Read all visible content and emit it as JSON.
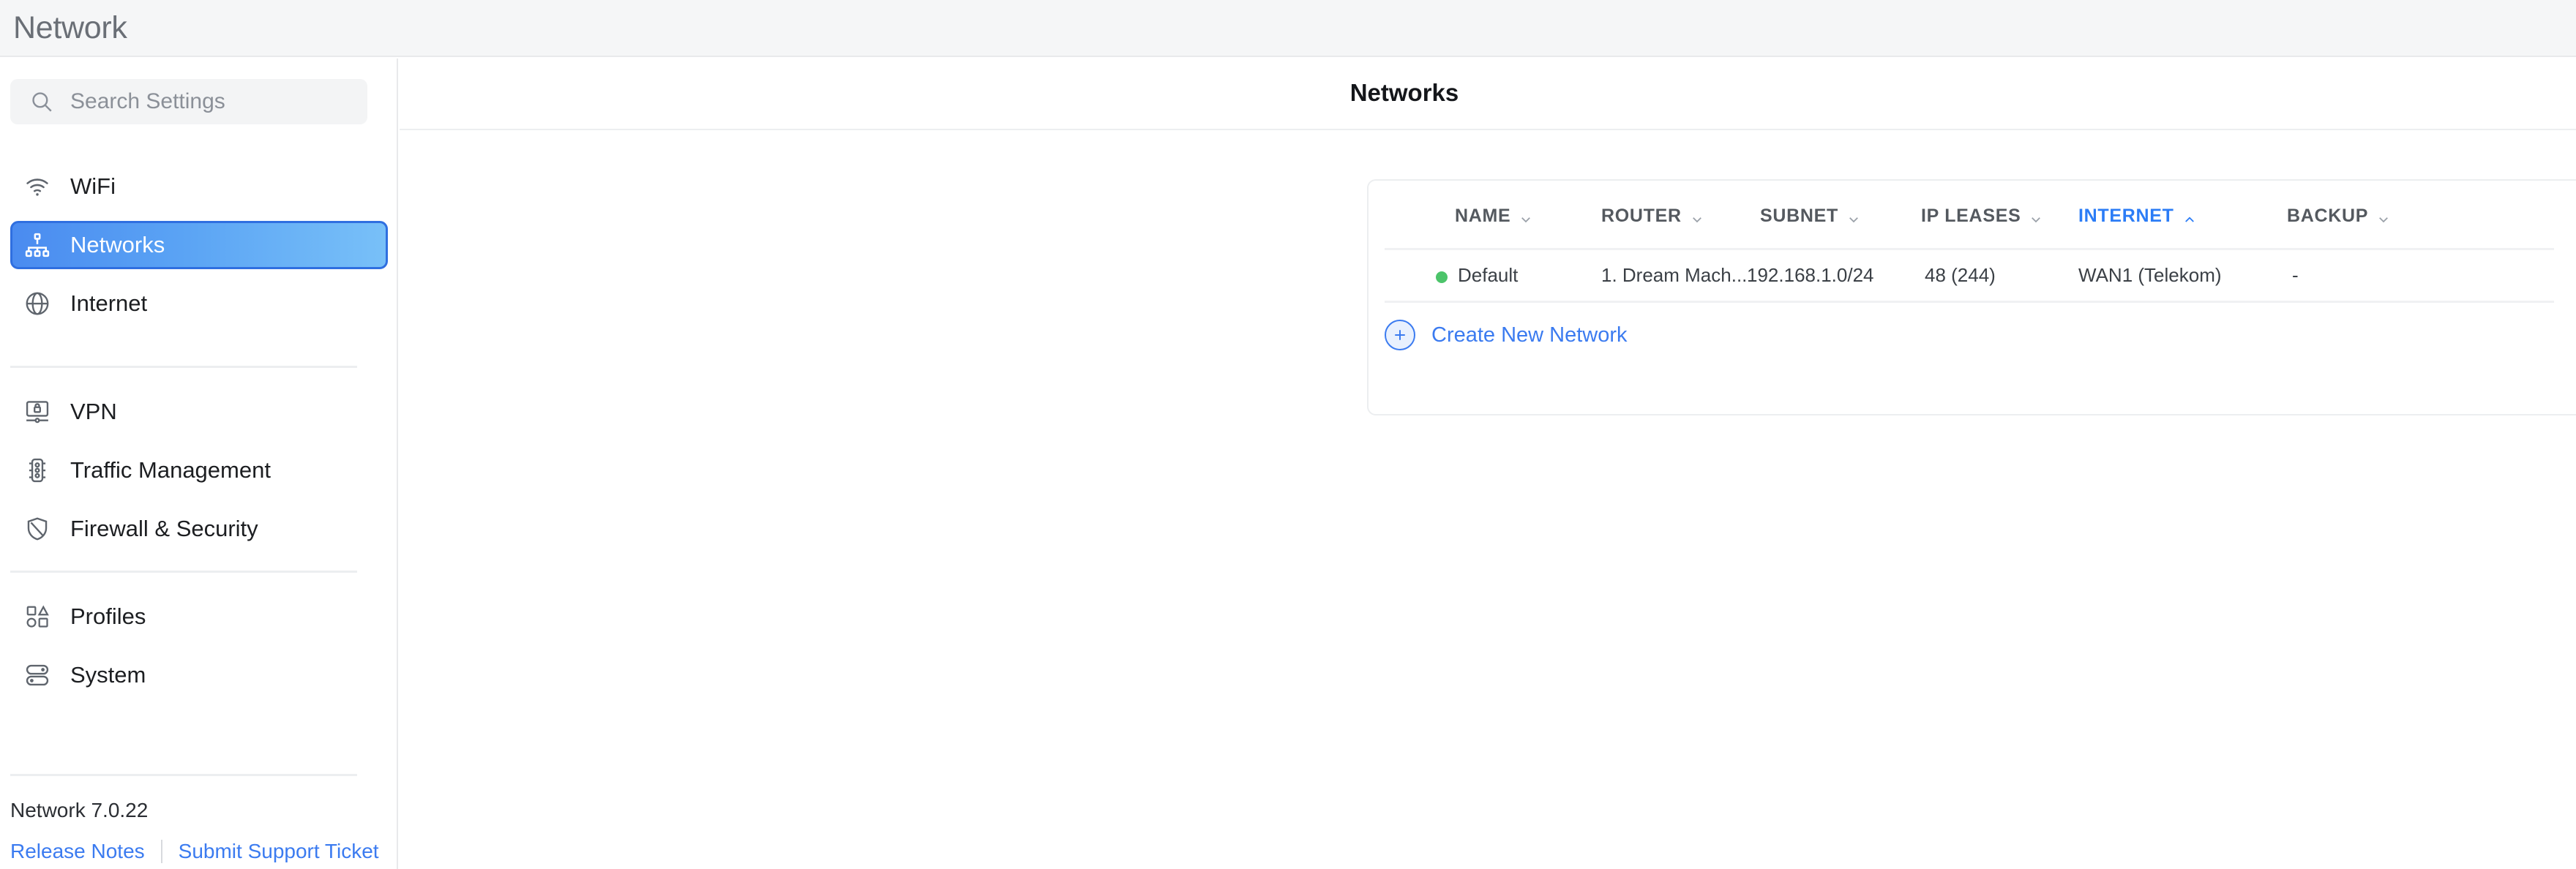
{
  "app": {
    "header_title": "Network"
  },
  "search": {
    "placeholder": "Search Settings",
    "icon": "search-icon"
  },
  "sidebar": {
    "groups": [
      {
        "items": [
          {
            "label": "WiFi",
            "icon": "wifi-icon",
            "active": false
          },
          {
            "label": "Networks",
            "icon": "network-topology-icon",
            "active": true
          },
          {
            "label": "Internet",
            "icon": "globe-icon",
            "active": false
          }
        ]
      },
      {
        "items": [
          {
            "label": "VPN",
            "icon": "vpn-lock-icon",
            "active": false
          },
          {
            "label": "Traffic Management",
            "icon": "traffic-light-icon",
            "active": false
          },
          {
            "label": "Firewall & Security",
            "icon": "shield-icon",
            "active": false
          }
        ]
      },
      {
        "items": [
          {
            "label": "Profiles",
            "icon": "shapes-icon",
            "active": false
          },
          {
            "label": "System",
            "icon": "toggles-icon",
            "active": false
          }
        ]
      }
    ],
    "footer": {
      "version": "Network 7.0.22",
      "release_notes": "Release Notes",
      "support_ticket": "Submit Support Ticket"
    }
  },
  "main": {
    "page_title": "Networks",
    "table": {
      "columns": [
        {
          "label": "NAME",
          "sorted": false,
          "sort_dir": "down"
        },
        {
          "label": "ROUTER",
          "sorted": false,
          "sort_dir": "down"
        },
        {
          "label": "SUBNET",
          "sorted": false,
          "sort_dir": "down"
        },
        {
          "label": "IP LEASES",
          "sorted": false,
          "sort_dir": "down"
        },
        {
          "label": "INTERNET",
          "sorted": true,
          "sort_dir": "up"
        },
        {
          "label": "BACKUP",
          "sorted": false,
          "sort_dir": "down"
        }
      ],
      "rows": [
        {
          "status_color": "#4cc46a",
          "name": "Default",
          "router": "1. Dream Mach...",
          "subnet": "192.168.1.0/24",
          "ip_leases": "48 (244)",
          "internet": "WAN1 (Telekom)",
          "backup": "-"
        }
      ]
    },
    "create_button": {
      "label": "Create New Network",
      "icon": "plus-circle-icon"
    }
  },
  "colors": {
    "accent_blue": "#3b7bf0",
    "sort_blue": "#2b7cf6",
    "status_green": "#4cc46a",
    "header_bg": "#f5f6f7"
  }
}
